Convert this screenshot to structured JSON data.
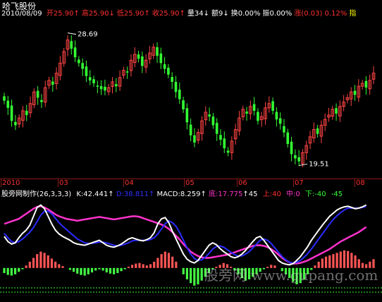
{
  "stock_name": "哈飞股份",
  "header": {
    "date": "2010/08/09",
    "items": [
      {
        "label": "开",
        "value": "25.90",
        "arrow": "↑",
        "color": "#ff3030"
      },
      {
        "label": "高",
        "value": "25.90",
        "arrow": "↓",
        "color": "#ff3030"
      },
      {
        "label": "低",
        "value": "25.90",
        "arrow": "↑",
        "color": "#ff3030"
      },
      {
        "label": "收",
        "value": "25.90",
        "arrow": "↑",
        "color": "#ff3030"
      },
      {
        "label": "量",
        "value": "34",
        "arrow": "↓",
        "color": "#ffffff"
      },
      {
        "label": "额",
        "value": "9",
        "arrow": "↓",
        "color": "#ffffff"
      },
      {
        "label": "换",
        "value": "0.00%",
        "arrow": "",
        "color": "#ffffff"
      },
      {
        "label": "振",
        "value": "0.00%",
        "arrow": "",
        "color": "#ffffff"
      },
      {
        "label": "涨",
        "value": "(0.03) 0.12%",
        "arrow": "",
        "color": "#ff3030"
      },
      {
        "label": "指",
        "value": "",
        "arrow": "",
        "color": "#ffff00"
      }
    ]
  },
  "indicator_bar": {
    "name": "股旁网制作",
    "params": "(26,3,3,3)",
    "k_label": "K:42.441",
    "d_label": "D:38.811",
    "macd_label": "MACD:8.259",
    "di_label": "底:17.775",
    "di_arrow_value": "45",
    "up_label": "上:40",
    "mid_label": "中:0",
    "down_label": "下:-40",
    "down_extra": "-45"
  },
  "watermark": "股旁网 www.gupang.com",
  "chart_data": [
    {
      "type": "candlestick",
      "title": "哈飞股份",
      "x_tick_labels": [
        "2010",
        "03",
        "04",
        "05",
        "06",
        "07",
        "08"
      ],
      "annotations": [
        {
          "text": "28.69",
          "value": 28.69,
          "kind": "high"
        },
        {
          "text": "19.51",
          "value": 19.51,
          "kind": "low"
        }
      ],
      "ylim": [
        19.0,
        29.5
      ],
      "close_values": [
        24.0,
        23.5,
        22.6,
        22.3,
        22.8,
        23.3,
        23.0,
        23.8,
        24.6,
        24.2,
        23.9,
        24.9,
        25.4,
        25.1,
        25.9,
        26.6,
        27.4,
        28.2,
        27.6,
        27.0,
        26.6,
        26.2,
        25.7,
        25.4,
        25.2,
        25.0,
        24.8,
        24.7,
        24.9,
        25.3,
        25.0,
        25.6,
        26.1,
        26.0,
        26.8,
        27.2,
        26.9,
        26.4,
        26.8,
        27.3,
        27.7,
        27.1,
        26.6,
        26.2,
        25.8,
        25.3,
        24.6,
        24.1,
        23.4,
        22.5,
        21.6,
        21.1,
        21.8,
        22.6,
        23.2,
        22.9,
        22.3,
        21.7,
        21.3,
        20.7,
        20.4,
        21.2,
        22.0,
        22.8,
        23.4,
        23.1,
        23.6,
        23.3,
        22.6,
        22.9,
        23.5,
        23.8,
        23.3,
        22.7,
        22.4,
        21.8,
        21.0,
        20.3,
        20.0,
        19.8,
        20.4,
        20.9,
        21.5,
        22.0,
        21.7,
        22.3,
        22.7,
        23.0,
        23.4,
        23.1,
        23.6,
        23.9,
        24.2,
        24.6,
        24.4,
        25.0,
        25.2,
        24.9,
        25.4,
        25.9
      ]
    },
    {
      "type": "indicator",
      "title": "股旁网制作(26,3,3,3)",
      "series": [
        {
          "name": "K",
          "color": "#ffffff",
          "values": [
            50,
            42,
            38,
            40,
            48,
            55,
            60,
            68,
            82,
            96,
            100,
            94,
            82,
            70,
            60,
            54,
            50,
            47,
            44,
            40,
            38,
            37,
            36,
            38,
            40,
            42,
            44,
            40,
            36,
            34,
            33,
            35,
            38,
            42,
            46,
            48,
            46,
            44,
            43,
            45,
            48,
            56,
            70,
            78,
            80,
            72,
            58,
            46,
            34,
            22,
            14,
            10,
            8,
            12,
            20,
            28,
            36,
            40,
            37,
            31,
            26,
            22,
            18,
            16,
            18,
            22,
            28,
            35,
            42,
            48,
            50,
            44,
            36,
            28,
            20,
            12,
            8,
            6,
            5,
            7,
            12,
            18,
            26,
            34,
            44,
            52,
            60,
            68,
            75,
            82,
            87,
            92,
            95,
            97,
            98,
            96,
            94,
            95,
            97,
            100
          ]
        },
        {
          "name": "D",
          "color": "#2b2bff",
          "values": [
            55,
            48,
            42,
            40,
            42,
            46,
            51,
            57,
            64,
            74,
            84,
            90,
            90,
            86,
            79,
            72,
            66,
            61,
            56,
            51,
            46,
            43,
            40,
            39,
            39,
            40,
            41,
            41,
            40,
            38,
            36,
            35,
            36,
            38,
            40,
            43,
            44,
            44,
            44,
            44,
            45,
            48,
            54,
            62,
            70,
            75,
            72,
            66,
            56,
            44,
            32,
            22,
            15,
            12,
            13,
            17,
            23,
            30,
            34,
            35,
            33,
            29,
            25,
            21,
            19,
            19,
            22,
            26,
            32,
            38,
            44,
            46,
            44,
            39,
            32,
            25,
            18,
            13,
            9,
            8,
            9,
            12,
            17,
            23,
            30,
            38,
            46,
            54,
            62,
            70,
            77,
            83,
            88,
            92,
            95,
            95,
            95,
            95,
            96,
            98
          ]
        },
        {
          "name": "底",
          "color": "#ff33cc",
          "values": [
            70,
            72,
            74,
            76,
            78,
            82,
            86,
            90,
            94,
            97,
            98,
            96,
            93,
            89,
            85,
            82,
            80,
            78,
            77,
            76,
            75,
            76,
            77,
            78,
            79,
            80,
            81,
            80,
            79,
            78,
            77,
            78,
            79,
            80,
            81,
            82,
            82,
            81,
            79,
            77,
            75,
            73,
            71,
            69,
            66,
            62,
            57,
            51,
            45,
            38,
            32,
            26,
            22,
            19,
            17,
            16,
            16,
            17,
            18,
            19,
            20,
            21,
            23,
            25,
            27,
            29,
            31,
            33,
            35,
            36,
            36,
            35,
            33,
            30,
            26,
            21,
            16,
            12,
            9,
            7,
            7,
            8,
            10,
            12,
            15,
            18,
            21,
            24,
            27,
            30,
            34,
            38,
            42,
            45,
            48,
            51,
            54,
            57,
            61,
            65
          ]
        },
        {
          "name": "MACD",
          "values": [
            -8,
            -11,
            -12,
            -10,
            -6,
            -2,
            4,
            10,
            16,
            22,
            26,
            24,
            20,
            15,
            10,
            6,
            3,
            0,
            -3,
            -6,
            -9,
            -11,
            -12,
            -10,
            -7,
            -4,
            -2,
            -4,
            -7,
            -9,
            -10,
            -8,
            -5,
            -2,
            2,
            5,
            7,
            8,
            6,
            4,
            6,
            10,
            16,
            22,
            26,
            24,
            18,
            10,
            0,
            -10,
            -18,
            -24,
            -28,
            -26,
            -20,
            -14,
            -8,
            -2,
            2,
            5,
            8,
            6,
            2,
            -4,
            -10,
            -16,
            -20,
            -18,
            -14,
            -10,
            -6,
            -2,
            2,
            5,
            4,
            0,
            -5,
            -10,
            -16,
            -22,
            -26,
            -24,
            -18,
            -10,
            -3,
            4,
            10,
            15,
            18,
            20,
            22,
            24,
            26,
            28,
            27,
            24,
            20,
            14,
            8,
            6,
            10,
            14
          ]
        },
        {
          "name": "上",
          "value": 40
        },
        {
          "name": "中",
          "value": 0
        },
        {
          "name": "下",
          "value": -40
        }
      ],
      "ylim": [
        -45,
        105
      ]
    }
  ]
}
